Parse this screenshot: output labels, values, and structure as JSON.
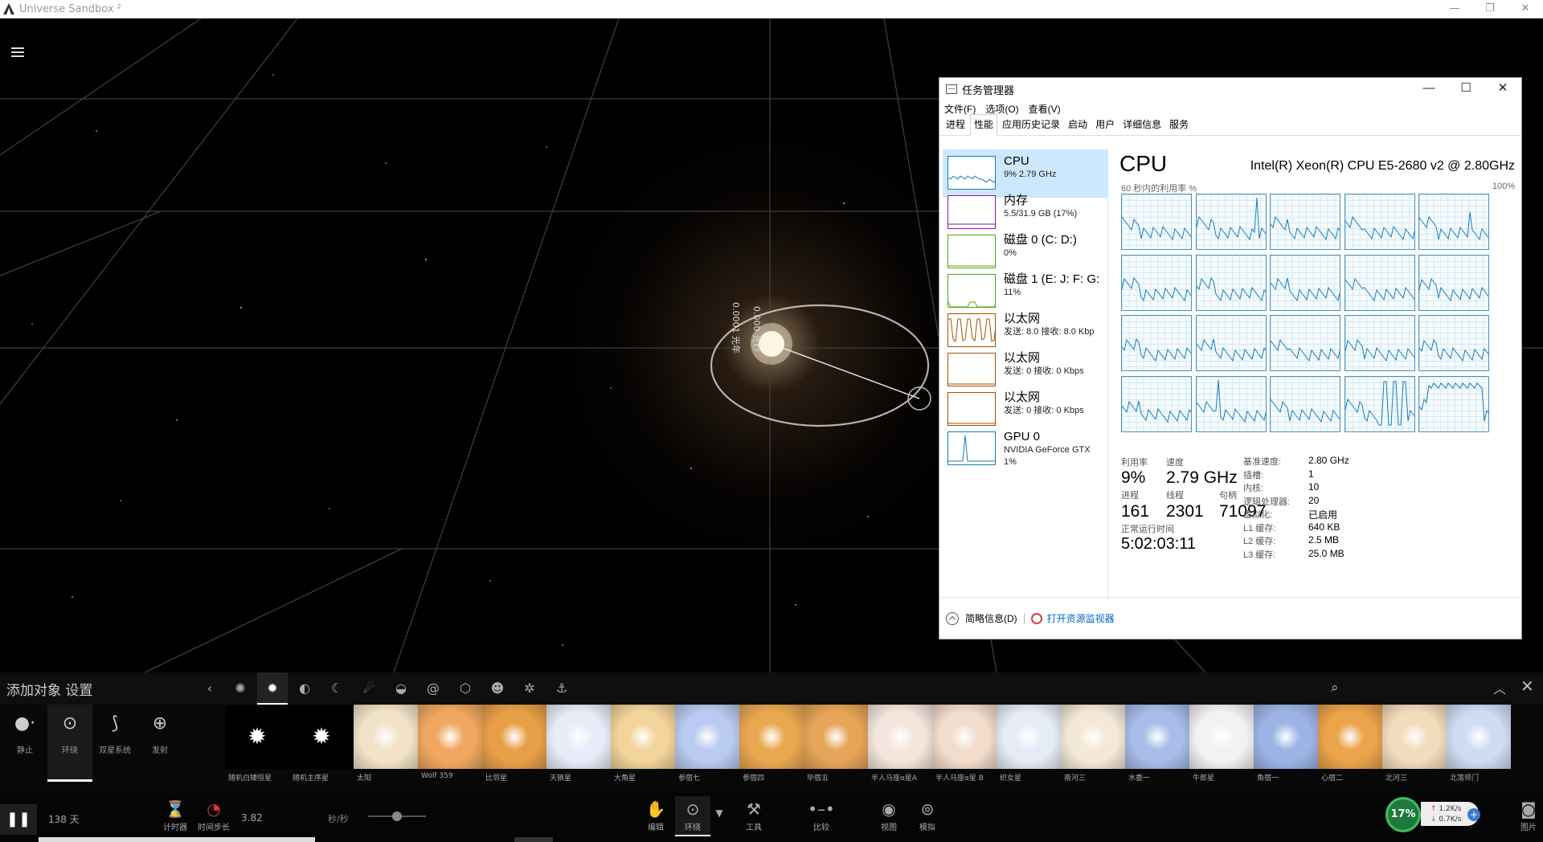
{
  "window": {
    "title": "Universe Sandbox ²"
  },
  "taskmgr": {
    "title": "任务管理器",
    "menu": [
      "文件(F)",
      "选项(O)",
      "查看(V)"
    ],
    "tabs": [
      "进程",
      "性能",
      "应用历史记录",
      "启动",
      "用户",
      "详细信息",
      "服务"
    ],
    "active_tab": "性能",
    "resources": [
      {
        "name": "CPU",
        "sub": "9% 2.79 GHz",
        "color": "#117dbb"
      },
      {
        "name": "内存",
        "sub": "5.5/31.9 GB (17%)",
        "color": "#8b12ae"
      },
      {
        "name": "磁盘 0 (C: D:)",
        "sub": "0%",
        "color": "#4da60c"
      },
      {
        "name": "磁盘 1 (E: J: F: G:",
        "sub": "11%",
        "color": "#4da60c"
      },
      {
        "name": "以太网",
        "sub": "发送: 8.0 接收: 8.0 Kbp",
        "color": "#a74f01"
      },
      {
        "name": "以太网",
        "sub": "发送: 0 接收: 0 Kbps",
        "color": "#a74f01"
      },
      {
        "name": "以太网",
        "sub": "发送: 0 接收: 0 Kbps",
        "color": "#a74f01"
      },
      {
        "name": "GPU 0",
        "sub": "NVIDIA GeForce GTX",
        "sub2": "1%",
        "color": "#117dbb"
      }
    ],
    "cpu": {
      "title": "CPU",
      "model": "Intel(R) Xeon(R) CPU E5-2680 v2 @ 2.80GHz",
      "util_label": "60 秒内的利用率 %",
      "util_max": "100%",
      "stats": {
        "util_label": "利用率",
        "util_value": "9%",
        "speed_label": "速度",
        "speed_value": "2.79 GHz",
        "proc_label": "进程",
        "proc_value": "161",
        "thread_label": "线程",
        "thread_value": "2301",
        "handle_label": "句柄",
        "handle_value": "71097",
        "uptime_label": "正常运行时间",
        "uptime_value": "5:02:03:11"
      },
      "specs": [
        {
          "label": "基准速度:",
          "value": "2.80 GHz"
        },
        {
          "label": "插槽:",
          "value": "1"
        },
        {
          "label": "内核:",
          "value": "10"
        },
        {
          "label": "逻辑处理器:",
          "value": "20"
        },
        {
          "label": "虚拟化:",
          "value": "已启用"
        },
        {
          "label": "L1 缓存:",
          "value": "640 KB"
        },
        {
          "label": "L2 缓存:",
          "value": "2.5 MB"
        },
        {
          "label": "L3 缓存:",
          "value": "25.0 MB"
        }
      ]
    },
    "footer": {
      "brief": "简略信息(D)",
      "monitor": "打开资源监视器"
    }
  },
  "scene": {
    "label_a": "0.0001 光年",
    "label_b": "0.000 光秒"
  },
  "panel": {
    "title": "添加对象 设置",
    "modes": [
      {
        "label": "静止",
        "icon": "dots-icon"
      },
      {
        "label": "环绕",
        "icon": "orbit-icon"
      },
      {
        "label": "双星系统",
        "icon": "binary-icon"
      },
      {
        "label": "发射",
        "icon": "crosshair-icon"
      }
    ],
    "special_objects": [
      {
        "label": "随机白矮恒星"
      },
      {
        "label": "随机主序星"
      }
    ],
    "objects": [
      {
        "label": "太阳",
        "color": "#f2e3c8"
      },
      {
        "label": "Wolf 359",
        "color": "#f0a860"
      },
      {
        "label": "比邻星",
        "color": "#e8a048"
      },
      {
        "label": "天狼星",
        "color": "#e8ecf8"
      },
      {
        "label": "大角星",
        "color": "#f3d49a"
      },
      {
        "label": "参宿七",
        "color": "#b9cbf0"
      },
      {
        "label": "参宿四",
        "color": "#e9a850"
      },
      {
        "label": "毕宿五",
        "color": "#e6a558"
      },
      {
        "label": "半人马座α星A",
        "color": "#f4e6dc"
      },
      {
        "label": "半人马座α星 B",
        "color": "#f2dccb"
      },
      {
        "label": "织女星",
        "color": "#e6ecf6"
      },
      {
        "label": "南河三",
        "color": "#f4e8d8"
      },
      {
        "label": "水委一",
        "color": "#a8bde9"
      },
      {
        "label": "牛郎星",
        "color": "#f2f2f4"
      },
      {
        "label": "角宿一",
        "color": "#9db4e6"
      },
      {
        "label": "心宿二",
        "color": "#eba44a"
      },
      {
        "label": "北河三",
        "color": "#f3dcbc"
      },
      {
        "label": "北落师门",
        "color": "#cfdcf4"
      }
    ]
  },
  "bottom": {
    "days": "138 天",
    "timer_label": "计时器",
    "timestep_label": "时间步长",
    "speed_value": "3.82",
    "speed_unit": "秒/秒",
    "tools": [
      {
        "label": "编辑",
        "icon": "hand-icon"
      },
      {
        "label": "环绕",
        "icon": "orbit-icon"
      },
      {
        "label": "工具",
        "icon": "tool-icon"
      },
      {
        "label": "比较",
        "icon": "compare-icon"
      },
      {
        "label": "视图",
        "icon": "eye-icon"
      },
      {
        "label": "模拟",
        "icon": "simulate-icon"
      },
      {
        "label": "图片",
        "icon": "camera-icon"
      }
    ],
    "net": {
      "cpu": "17%",
      "up": "1.2K/s",
      "down": "0.7K/s"
    }
  }
}
